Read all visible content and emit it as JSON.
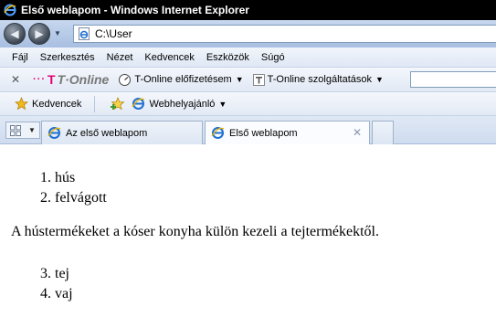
{
  "window": {
    "title": "Első weblapom - Windows Internet Explorer"
  },
  "address": {
    "url": "C:\\User"
  },
  "menu": {
    "items": [
      "Fájl",
      "Szerkesztés",
      "Nézet",
      "Kedvencek",
      "Eszközök",
      "Súgó"
    ]
  },
  "toolbar": {
    "logo_text": "T·Online",
    "subscription_label": "T-Online előfizetésem",
    "services_label": "T-Online szolgáltatások"
  },
  "favorites": {
    "favorites_label": "Kedvencek",
    "suggested_label": "Webhelyajánló"
  },
  "tabs": [
    {
      "label": "Az első weblapom"
    },
    {
      "label": "Első weblapom"
    }
  ],
  "page": {
    "list1": [
      {
        "num": "1.",
        "text": "hús"
      },
      {
        "num": "2.",
        "text": "felvágott"
      }
    ],
    "paragraph": "A hústermékeket a kóser konyha külön kezeli a tejtermékektől.",
    "list2": [
      {
        "num": "3.",
        "text": "tej"
      },
      {
        "num": "4.",
        "text": "vaj"
      }
    ]
  },
  "colors": {
    "brand_magenta": "#e20074",
    "ie_blue": "#1f6fd1",
    "title_bg": "#000000"
  }
}
